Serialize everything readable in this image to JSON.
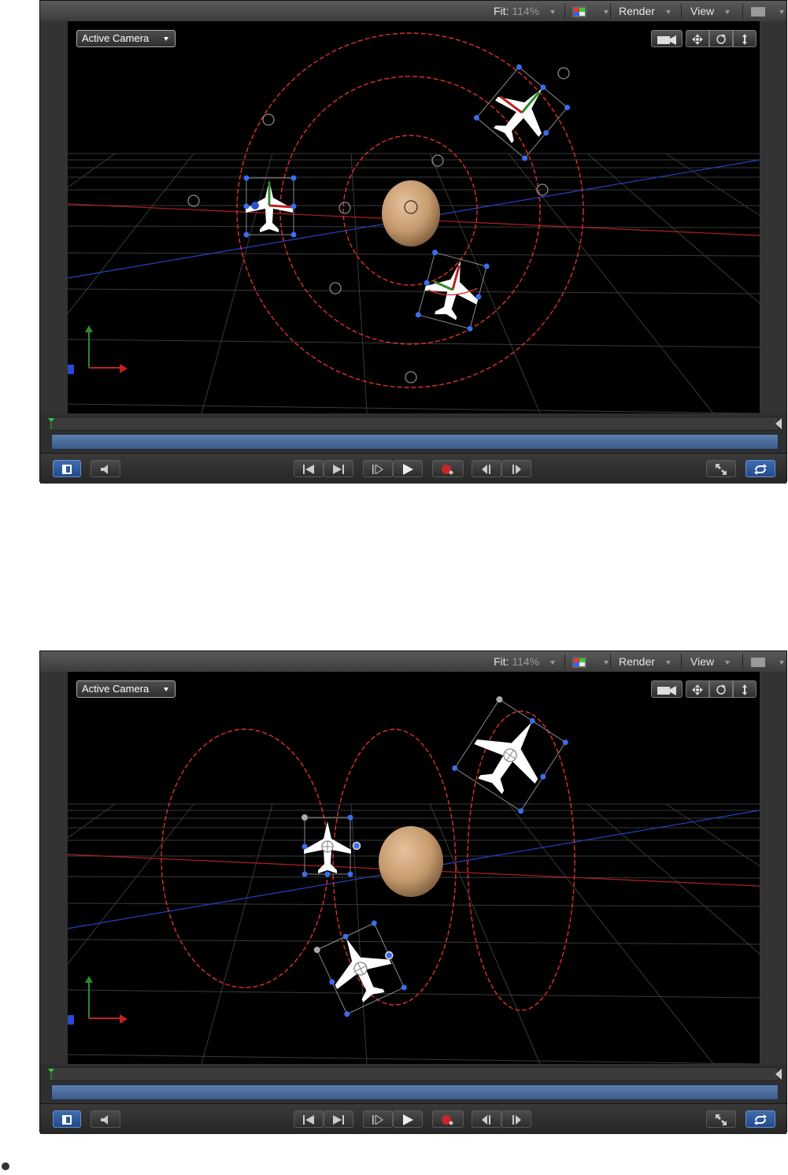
{
  "viewers": [
    {
      "topbar": {
        "fit_label": "Fit:",
        "fit_value": "114%",
        "render_label": "Render",
        "view_label": "View"
      },
      "camera_menu": "Active Camera"
    },
    {
      "topbar": {
        "fit_label": "Fit:",
        "fit_value": "114%",
        "render_label": "Render",
        "view_label": "View"
      },
      "camera_menu": "Active Camera"
    }
  ],
  "icons": {
    "color_channels": "color-channels-icon",
    "layout": "layout-icon",
    "camera": "camera-icon",
    "pan": "pan-icon",
    "orbit": "orbit-icon",
    "dolly": "dolly-icon",
    "play": "play-icon",
    "record": "record-icon",
    "loop": "loop-icon"
  },
  "colors": {
    "accent_blue": "#3f6db0",
    "path_red": "#e03030",
    "sphere": "#c9a07a",
    "canvas_bg": "#000000"
  }
}
